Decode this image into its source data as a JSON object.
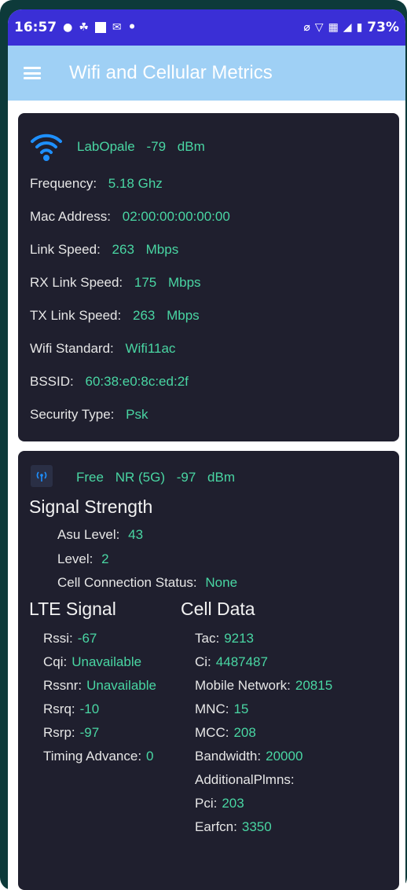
{
  "status_bar": {
    "time": "16:57",
    "dot": "•",
    "battery": "73%"
  },
  "app_bar": {
    "title": "Wifi and Cellular Metrics",
    "menu_icon": "menu-icon"
  },
  "wifi": {
    "ssid": "LabOpale",
    "rssi": "-79",
    "rssi_unit": "dBm",
    "rows": [
      {
        "label": "Frequency:",
        "value": "5.18 Ghz"
      },
      {
        "label": "Mac Address:",
        "value": "02:00:00:00:00:00"
      },
      {
        "label": "Link Speed:",
        "value": "263",
        "unit": "Mbps"
      },
      {
        "label": "RX Link Speed:",
        "value": "175",
        "unit": "Mbps"
      },
      {
        "label": "TX Link Speed:",
        "value": "263",
        "unit": "Mbps"
      },
      {
        "label": "Wifi Standard:",
        "value": "Wifi11ac"
      },
      {
        "label": "BSSID:",
        "value": "60:38:e0:8c:ed:2f"
      },
      {
        "label": "Security Type:",
        "value": "Psk"
      }
    ]
  },
  "cell": {
    "operator": "Free",
    "network_type": "NR (5G)",
    "rssi": "-97",
    "rssi_unit": "dBm",
    "signal_strength": {
      "heading": "Signal Strength",
      "asu_label": "Asu Level:",
      "asu_value": "43",
      "level_label": "Level:",
      "level_value": "2",
      "status_label": "Cell Connection Status:",
      "status_value": "None"
    },
    "lte_signal": {
      "heading": "LTE Signal",
      "rows": [
        {
          "label": "Rssi:",
          "value": "-67"
        },
        {
          "label": "Cqi:",
          "value": "Unavailable"
        },
        {
          "label": "Rssnr:",
          "value": "Unavailable"
        },
        {
          "label": "Rsrq:",
          "value": "-10"
        },
        {
          "label": "Rsrp:",
          "value": "-97"
        },
        {
          "label": "Timing Advance:",
          "value": "0"
        }
      ]
    },
    "cell_data": {
      "heading": "Cell Data",
      "rows": [
        {
          "label": "Tac:",
          "value": "9213"
        },
        {
          "label": "Ci:",
          "value": "4487487"
        },
        {
          "label": "Mobile Network:",
          "value": "20815"
        },
        {
          "label": "MNC:",
          "value": "15"
        },
        {
          "label": "MCC:",
          "value": "208"
        },
        {
          "label": "Bandwidth:",
          "value": "20000"
        },
        {
          "label": "AdditionalPlmns:",
          "value": ""
        },
        {
          "label": "Pci:",
          "value": "203"
        },
        {
          "label": "Earfcn:",
          "value": "3350"
        }
      ]
    }
  },
  "colors": {
    "status_bar": "#3a2fd6",
    "app_bar": "#9fd0f5",
    "card_bg": "#1f1f2e",
    "value_green": "#49d6a3",
    "frame": "#0d3a3a"
  }
}
